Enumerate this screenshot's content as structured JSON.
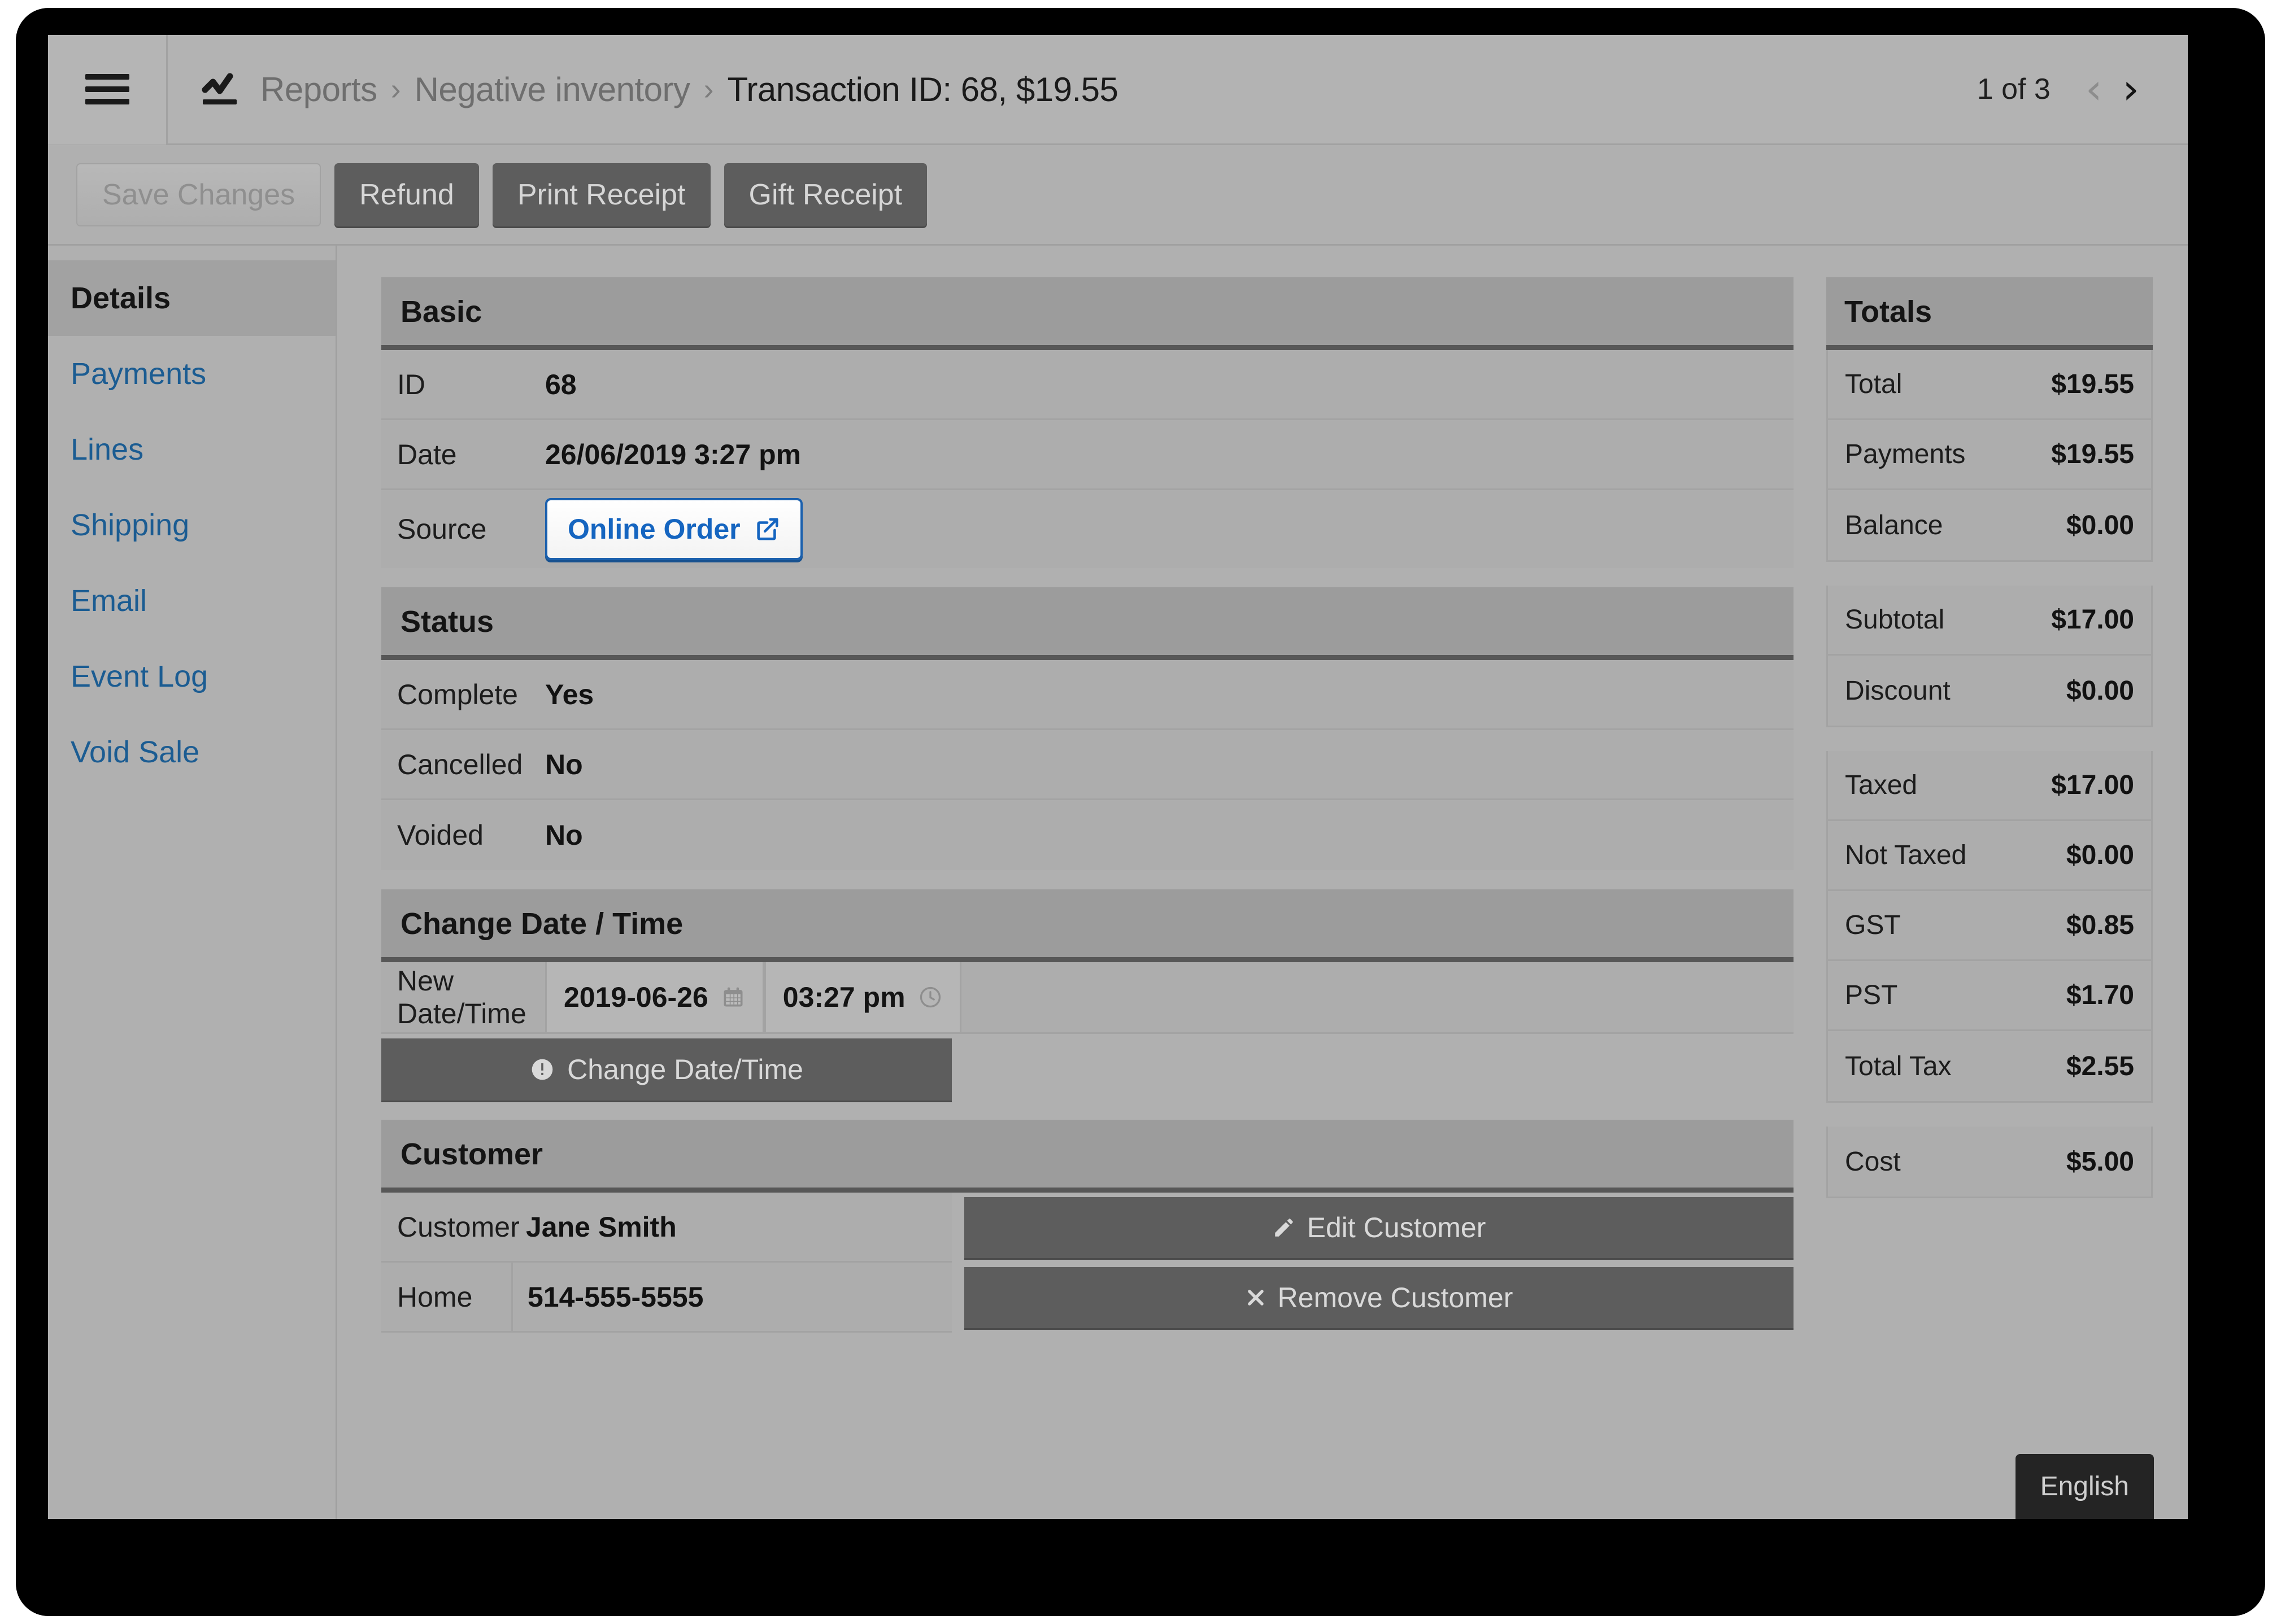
{
  "header": {
    "menu_icon": "hamburger-icon",
    "breadcrumb_icon": "line-chart-icon",
    "crumbs": [
      "Reports",
      "Negative inventory"
    ],
    "separator": "›",
    "current": "Transaction ID: 68, $19.55",
    "pager": {
      "count": "1 of 3",
      "prev_icon": "chevron-left-icon",
      "next_icon": "chevron-right-icon"
    }
  },
  "toolbar": {
    "save_label": "Save Changes",
    "refund_label": "Refund",
    "print_receipt_label": "Print Receipt",
    "gift_receipt_label": "Gift Receipt"
  },
  "sidebar": {
    "items": [
      {
        "label": "Details"
      },
      {
        "label": "Payments"
      },
      {
        "label": "Lines"
      },
      {
        "label": "Shipping"
      },
      {
        "label": "Email"
      },
      {
        "label": "Event Log"
      },
      {
        "label": "Void Sale"
      }
    ]
  },
  "basic": {
    "title": "Basic",
    "id_label": "ID",
    "id_value": "68",
    "date_label": "Date",
    "date_value": "26/06/2019 3:27 pm",
    "source_label": "Source",
    "source_button": "Online Order"
  },
  "status": {
    "title": "Status",
    "rows": [
      {
        "label": "Complete",
        "value": "Yes"
      },
      {
        "label": "Cancelled",
        "value": "No"
      },
      {
        "label": "Voided",
        "value": "No"
      }
    ]
  },
  "change_datetime": {
    "title": "Change Date / Time",
    "row_label": "New Date/Time",
    "date_value": "2019-06-26",
    "time_value": "03:27 pm",
    "button_label": "Change Date/Time"
  },
  "customer": {
    "title": "Customer",
    "customer_label": "Customer",
    "customer_name": "Jane Smith",
    "home_label": "Home",
    "home_phone": "514-555-5555",
    "edit_button": "Edit Customer",
    "remove_button": "Remove Customer"
  },
  "totals": {
    "title": "Totals",
    "group1": [
      {
        "label": "Total",
        "value": "$19.55"
      },
      {
        "label": "Payments",
        "value": "$19.55"
      },
      {
        "label": "Balance",
        "value": "$0.00"
      }
    ],
    "group2": [
      {
        "label": "Subtotal",
        "value": "$17.00"
      },
      {
        "label": "Discount",
        "value": "$0.00"
      }
    ],
    "group3": [
      {
        "label": "Taxed",
        "value": "$17.00"
      },
      {
        "label": "Not Taxed",
        "value": "$0.00"
      },
      {
        "label": "GST",
        "value": "$0.85"
      },
      {
        "label": "PST",
        "value": "$1.70"
      },
      {
        "label": "Total Tax",
        "value": "$2.55"
      }
    ],
    "group4": [
      {
        "label": "Cost",
        "value": "$5.00"
      }
    ]
  },
  "language_badge": "English",
  "colors": {
    "link_blue": "#1b5c92",
    "button_blue": "#1565c0",
    "dark_button": "#5d5d5d",
    "panel_header": "#9c9c9c",
    "panel_body": "#adadad"
  }
}
